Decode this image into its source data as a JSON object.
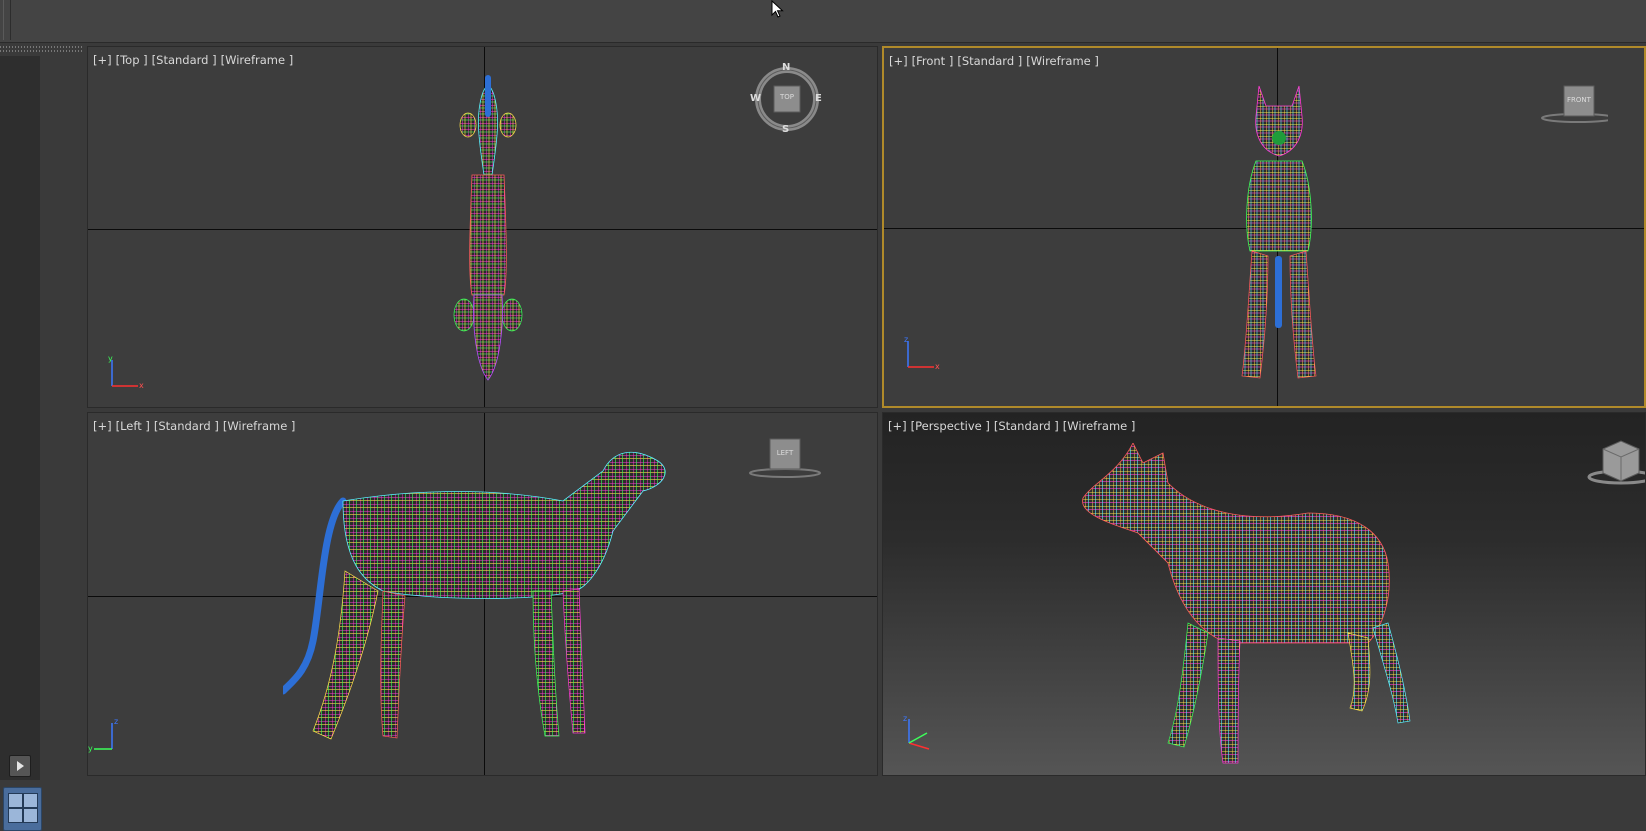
{
  "viewports": {
    "top": {
      "plus": "[+]",
      "view": "[Top ]",
      "shading": "[Standard ]",
      "mode": "[Wireframe ]",
      "cube": "TOP",
      "compass": {
        "n": "N",
        "s": "S",
        "e": "E",
        "w": "W"
      }
    },
    "front": {
      "plus": "[+]",
      "view": "[Front ]",
      "shading": "[Standard ]",
      "mode": "[Wireframe ]",
      "cube": "FRONT"
    },
    "left": {
      "plus": "[+]",
      "view": "[Left ]",
      "shading": "[Standard ]",
      "mode": "[Wireframe ]",
      "cube": "LEFT"
    },
    "persp": {
      "plus": "[+]",
      "view": "[Perspective ]",
      "shading": "[Standard ]",
      "mode": "[Wireframe ]"
    }
  },
  "axis_labels": {
    "x": "x",
    "y": "y",
    "z": "z"
  },
  "colors": {
    "active_border": "#b08a2a",
    "wire_palette": [
      "#ff3bd4",
      "#3cff5a",
      "#ffe14a",
      "#59f0ff",
      "#ff5a5a",
      "#b84dff",
      "#ffffff",
      "#ff9a3b"
    ],
    "tail": "#2d6fd6"
  },
  "icons": {
    "play": "play-icon",
    "layout": "viewport-layout-icon",
    "cursor": "mouse-cursor-icon"
  }
}
